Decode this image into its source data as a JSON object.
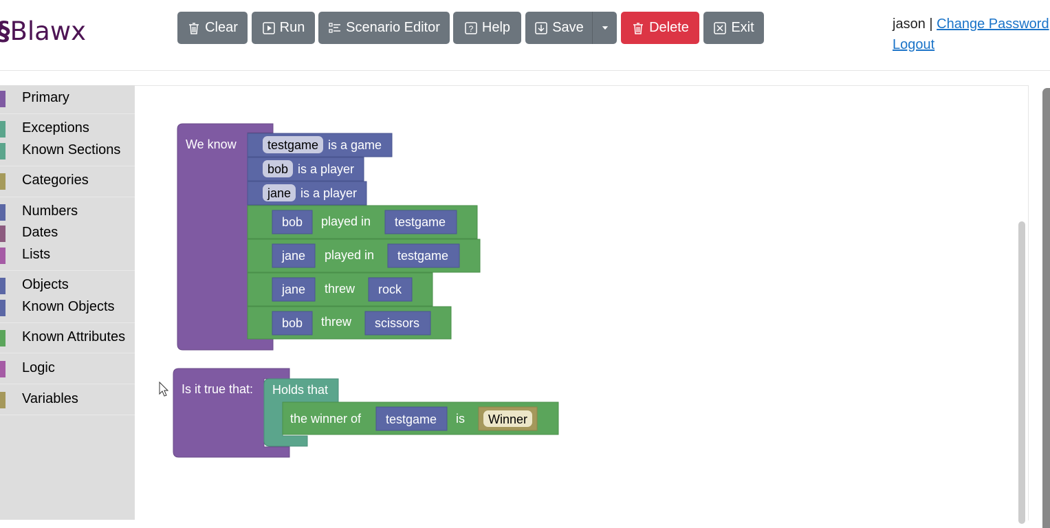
{
  "app": {
    "logo_text": "Blawx"
  },
  "toolbar": {
    "clear": "Clear",
    "run": "Run",
    "scenario_editor": "Scenario Editor",
    "help": "Help",
    "save": "Save",
    "delete": "Delete",
    "exit": "Exit"
  },
  "user": {
    "name": "jason",
    "separator": "|",
    "change_password": "Change Password",
    "logout": "Logout"
  },
  "sidebar": {
    "items": [
      {
        "label": "Primary",
        "color": "#7f5aa2"
      },
      {
        "label": "Exceptions",
        "color": "#5ba58c"
      },
      {
        "label": "Known Sections",
        "color": "#5ba58c"
      },
      {
        "label": "Categories",
        "color": "#a59a5b"
      },
      {
        "label": "Numbers",
        "color": "#5b67a5"
      },
      {
        "label": "Dates",
        "color": "#8c5b7f"
      },
      {
        "label": "Lists",
        "color": "#a55ba5"
      },
      {
        "label": "Objects",
        "color": "#5b67a5"
      },
      {
        "label": "Known Objects",
        "color": "#5b67a5"
      },
      {
        "label": "Known Attributes",
        "color": "#5ba55b"
      },
      {
        "label": "Logic",
        "color": "#a55ba5"
      },
      {
        "label": "Variables",
        "color": "#a5985b"
      }
    ]
  },
  "blocks": {
    "fact": {
      "header": "We know",
      "category_facts": [
        {
          "object": "testgame",
          "text": "is a game"
        },
        {
          "object": "bob",
          "text": "is a player"
        },
        {
          "object": "jane",
          "text": "is a player"
        }
      ],
      "attribute_facts": [
        {
          "subject": "bob",
          "verb": "played in",
          "object": "testgame"
        },
        {
          "subject": "jane",
          "verb": "played in",
          "object": "testgame"
        },
        {
          "subject": "jane",
          "verb": "threw",
          "object": "rock"
        },
        {
          "subject": "bob",
          "verb": "threw",
          "object": "scissors"
        }
      ]
    },
    "query": {
      "header": "Is it true that:",
      "holds": "Holds that",
      "attr_prefix": "the winner of",
      "attr_object": "testgame",
      "attr_is": "is",
      "variable": "Winner"
    }
  },
  "colors": {
    "primary": "#7f5aa2",
    "object": "#5b67a5",
    "attribute": "#5ba55b",
    "exception": "#5ba58c",
    "variable": "#a5985b",
    "button": "#6c757d",
    "danger": "#dc3545"
  }
}
